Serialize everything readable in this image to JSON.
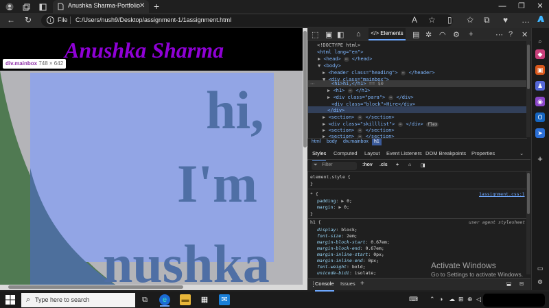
{
  "browser": {
    "tab_title": "Anushka Sharma-Portfolio",
    "tab_close": "✕",
    "new_tab": "+",
    "address_label": "File",
    "url": "C:/Users/nush9/Desktop/assignment-1/1assignment.html"
  },
  "page": {
    "heading": "Anushka Sharma",
    "h1_line1": "hi,",
    "h1_line2": "I'm",
    "h1_line3": "nushka",
    "tooltip_element": "div.mainbox",
    "tooltip_dimensions": "748 × 642"
  },
  "devtools": {
    "active_tab": "Elements",
    "dom": [
      "<!DOCTYPE html>",
      "<html lang=\"en\">",
      "<head>",
      "<body>",
      "<header class=\"heading\">",
      "<div class=\"mainbox\">",
      "<h1>hi,</h1>",
      "== $0",
      "<h1>",
      "</h1>",
      "<div class=\"para\">",
      "</div>",
      "<div class=\"block\">Hire</div>",
      "</div>",
      "<section>",
      "</section>",
      "<div class=\"skilllist\">",
      "flex",
      "<section>",
      "<section>"
    ],
    "breadcrumbs": [
      "html",
      "body",
      "div.mainbox",
      "h1"
    ],
    "subtabs": [
      "Styles",
      "Computed",
      "Layout",
      "Event Listeners",
      "DOM Breakpoints",
      "Properties"
    ],
    "filter_placeholder": "Filter",
    "hov": ":hov",
    "cls": ".cls",
    "styles": {
      "element_style": "element.style {",
      "close": "}",
      "star_selector": "* {",
      "star_source": "1assignment.css:1",
      "star_props": [
        {
          "name": "padding",
          "value": "0;"
        },
        {
          "name": "margin",
          "value": "0;"
        }
      ],
      "h1_selector": "h1 {",
      "h1_source": "user agent stylesheet",
      "h1_props": [
        {
          "name": "display",
          "value": "block;"
        },
        {
          "name": "font-size",
          "value": "2em;"
        },
        {
          "name": "margin-block-start",
          "value": "0.67em;"
        },
        {
          "name": "margin-block-end",
          "value": "0.67em;"
        },
        {
          "name": "margin-inline-start",
          "value": "0px;"
        },
        {
          "name": "margin-inline-end",
          "value": "0px;"
        },
        {
          "name": "font-weight",
          "value": "bold;"
        },
        {
          "name": "unicode-bidi",
          "value": "isolate;"
        }
      ]
    },
    "drawer_tabs": [
      "Console",
      "Issues"
    ]
  },
  "watermark": {
    "title": "Activate Windows",
    "subtitle": "Go to Settings to activate Windows."
  },
  "taskbar": {
    "search_placeholder": "Type here to search"
  },
  "colors": {
    "heading_purple": "#8f00d6",
    "h1_box": "#92a5e5",
    "h1_text": "#4f6fa5",
    "devtools_accent": "#6ea8ff"
  }
}
